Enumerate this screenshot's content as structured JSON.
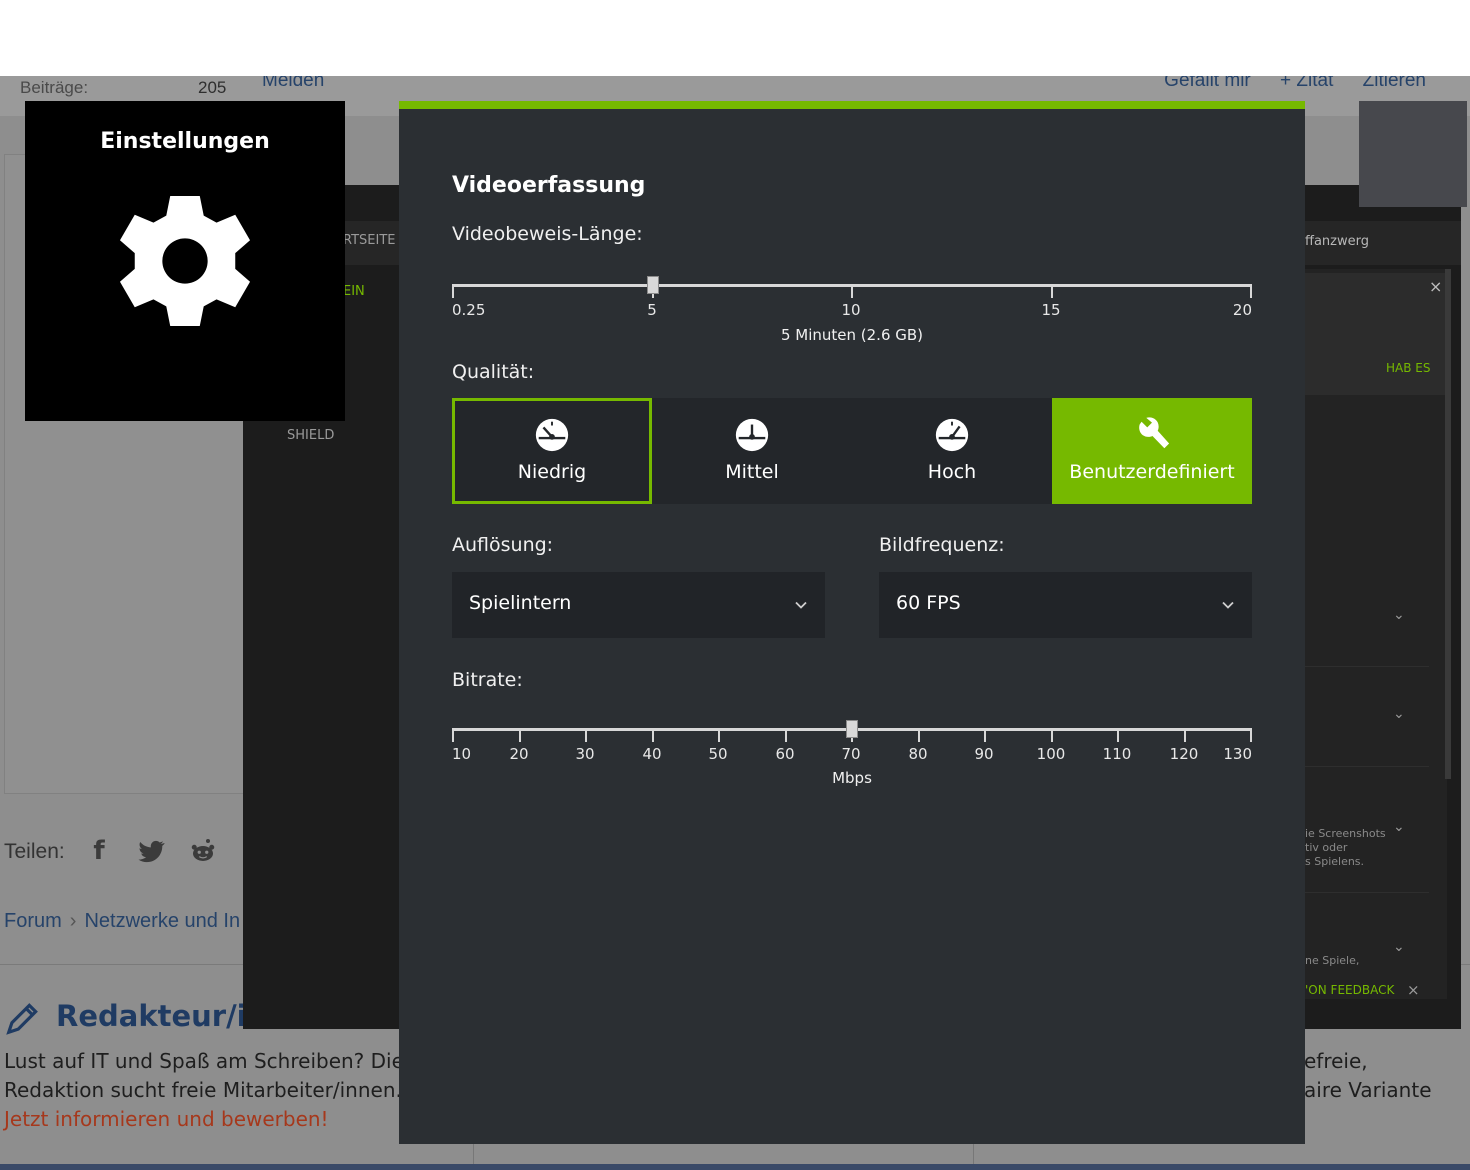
{
  "forum": {
    "posts_label": "Beiträge:",
    "posts_value": "205",
    "report": "Melden",
    "like": "Gefällt mir",
    "quote_plus": "+ Zitat",
    "quote": "Zitieren",
    "share_label": "Teilen:",
    "breadcrumb": [
      "Forum",
      "Netzwerke und In"
    ],
    "promo_title": "Redakteur/in",
    "promo_line1": "Lust auf IT und Spaß am Schreiben? Die",
    "promo_line2": "Redaktion sucht freie Mitarbeiter/innen.",
    "promo_link": "Jetzt informieren und bewerben!",
    "right_line1": "efreie,",
    "right_line2": "aire Variante"
  },
  "overlay_app": {
    "nav_left": "RTSEITE",
    "nav_right": "ffanzwerg",
    "sub_left": "EIN",
    "shield": "SHIELD",
    "popup_close": "×",
    "hab_es": "HAB ES",
    "rows_text": [
      "ie Screenshots",
      "tiv oder",
      "s Spielens.",
      "ne Spiele,"
    ],
    "feedback": "'ON FEEDBACK",
    "feedback_close": "×"
  },
  "settings_tile": {
    "title": "Einstellungen",
    "icon": "gear-icon"
  },
  "modal": {
    "accent_color": "#76b900",
    "section_title": "Videoerfassung",
    "replay_length": {
      "label": "Videobeweis-Länge:",
      "ticks": [
        "0.25",
        "5",
        "10",
        "15",
        "20"
      ],
      "min": 0.25,
      "max": 20,
      "value": 5,
      "caption": "5 Minuten (2.6 GB)"
    },
    "quality": {
      "label": "Qualität:",
      "options": [
        {
          "label": "Niedrig",
          "icon": "gauge-low-icon"
        },
        {
          "label": "Mittel",
          "icon": "gauge-medium-icon"
        },
        {
          "label": "Hoch",
          "icon": "gauge-high-icon"
        },
        {
          "label": "Benutzerdefiniert",
          "icon": "wrench-icon"
        }
      ],
      "focused": "Niedrig",
      "selected": "Benutzerdefiniert"
    },
    "resolution": {
      "label": "Auflösung:",
      "value": "Spielintern"
    },
    "framerate": {
      "label": "Bildfrequenz:",
      "value": "60 FPS"
    },
    "bitrate": {
      "label": "Bitrate:",
      "ticks": [
        "10",
        "20",
        "30",
        "40",
        "50",
        "60",
        "70",
        "80",
        "90",
        "100",
        "110",
        "120",
        "130"
      ],
      "min": 10,
      "max": 130,
      "value": 70,
      "caption": "Mbps"
    }
  }
}
